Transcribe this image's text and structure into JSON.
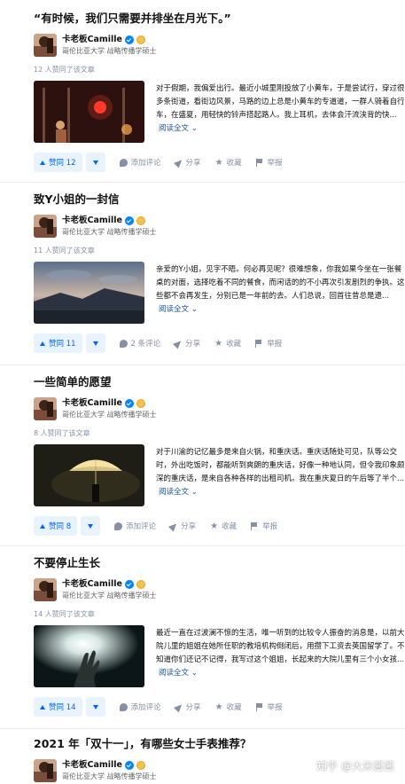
{
  "cards": [
    {
      "title": "“有时候，我们只需要并排坐在月光下。”",
      "author": {
        "name": "卡老板Camille",
        "bio": "哥伦比亚大学 战略传播学硕士"
      },
      "votes_text": "12 人赞同了该文章",
      "excerpt": "对于假期，我偏爱出行。最近小城里刚投放了小黄车，于是尝试行，穿过很多条街道，看街边风景，马路的边上总是小黄车的专道道，一群人骑着自行车，在盛夏，用轻快的铃声搭起路人。我上耳机，去体会汗流浃背的快...",
      "more": "阅读全文",
      "vote_label": "赞同 12",
      "comment_label": "添加评论",
      "share_label": "分享",
      "fav_label": "收藏",
      "report_label": "举报"
    },
    {
      "title": "致Y小姐的一封信",
      "author": {
        "name": "卡老板Camille",
        "bio": "哥伦比亚大学 战略传播学硕士"
      },
      "votes_text": "11 人赞同了该文章",
      "excerpt": "亲爱的Y小姐，见字不晤。何必再见呢？很难想象，你我如果今坐在一张餐桌的对面，选择吃着不同的餐食，而闲话的的不小再次引发剧烈的争执。这些都不会再发生，分别已是一年前的去。人们总说，回首往昔总是遗...",
      "more": "阅读全文",
      "vote_label": "赞同 11",
      "comment_label": "2 条评论",
      "share_label": "分享",
      "fav_label": "收藏",
      "report_label": "举报"
    },
    {
      "title": "一些简单的愿望",
      "author": {
        "name": "卡老板Camille",
        "bio": "哥伦比亚大学 战略传播学硕士"
      },
      "votes_text": "8 人赞同了该文章",
      "excerpt": "对于川渝的记忆最多是来自火锅，和重庆话。重庆话随处可见，队等公交时，外出吃饭时，都能听到爽朗的重庆话，好像一种地认同，但令我印象颇深的重庆话，是来自各种各样的出租司机。我在重庆夏日的午后等了半个...",
      "more": "阅读全文",
      "vote_label": "赞同 8",
      "comment_label": "添加评论",
      "share_label": "分享",
      "fav_label": "收藏",
      "report_label": "举报"
    },
    {
      "title": "不要停止生长",
      "author": {
        "name": "卡老板Camille",
        "bio": "哥伦比亚大学 战略传播学硕士"
      },
      "votes_text": "14 人赞同了该文章",
      "excerpt": "最近一直在过波澜不惊的生活，唯一听到的比较令人振奋的消息是，以前大院儿里的姐姐在她所任职的教培机构倒闭后，用攒下工资去英国留学了。不知道你们还记不记得，我写过这个姐姐，长起来的大院儿里有三个小女孩...",
      "more": "阅读全文",
      "vote_label": "赞同 14",
      "comment_label": "添加评论",
      "share_label": "分享",
      "fav_label": "收藏",
      "report_label": "举报"
    },
    {
      "title": "2021 年「双十一」，有哪些女士手表推荐？",
      "author": {
        "name": "卡老板Camille",
        "bio": "哥伦比亚大学 战略传播学硕士"
      }
    }
  ],
  "watermark": "知乎 @大米酱酱"
}
